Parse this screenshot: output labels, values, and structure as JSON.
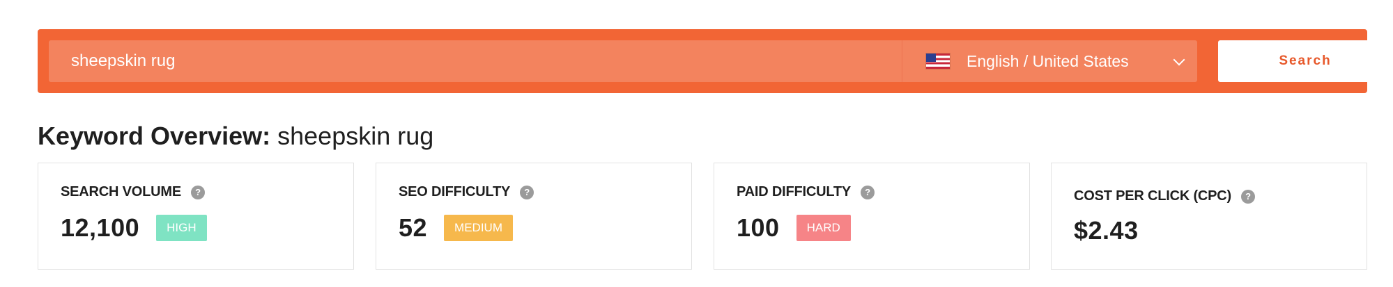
{
  "search": {
    "query": "sheepskin rug",
    "locale": "English / United States",
    "button_label": "Search"
  },
  "overview": {
    "title_label": "Keyword Overview:",
    "keyword": "sheepskin rug"
  },
  "metrics": [
    {
      "label": "SEARCH VOLUME",
      "value": "12,100",
      "badge": "HIGH",
      "badge_color": "#7fe3c3"
    },
    {
      "label": "SEO DIFFICULTY",
      "value": "52",
      "badge": "MEDIUM",
      "badge_color": "#f6b84c"
    },
    {
      "label": "PAID DIFFICULTY",
      "value": "100",
      "badge": "HARD",
      "badge_color": "#f68487"
    },
    {
      "label": "COST PER CLICK (CPC)",
      "value": "$2.43"
    }
  ],
  "icons": {
    "help": "?"
  },
  "colors": {
    "brand_orange": "#f26535",
    "input_orange": "#f3835e"
  }
}
